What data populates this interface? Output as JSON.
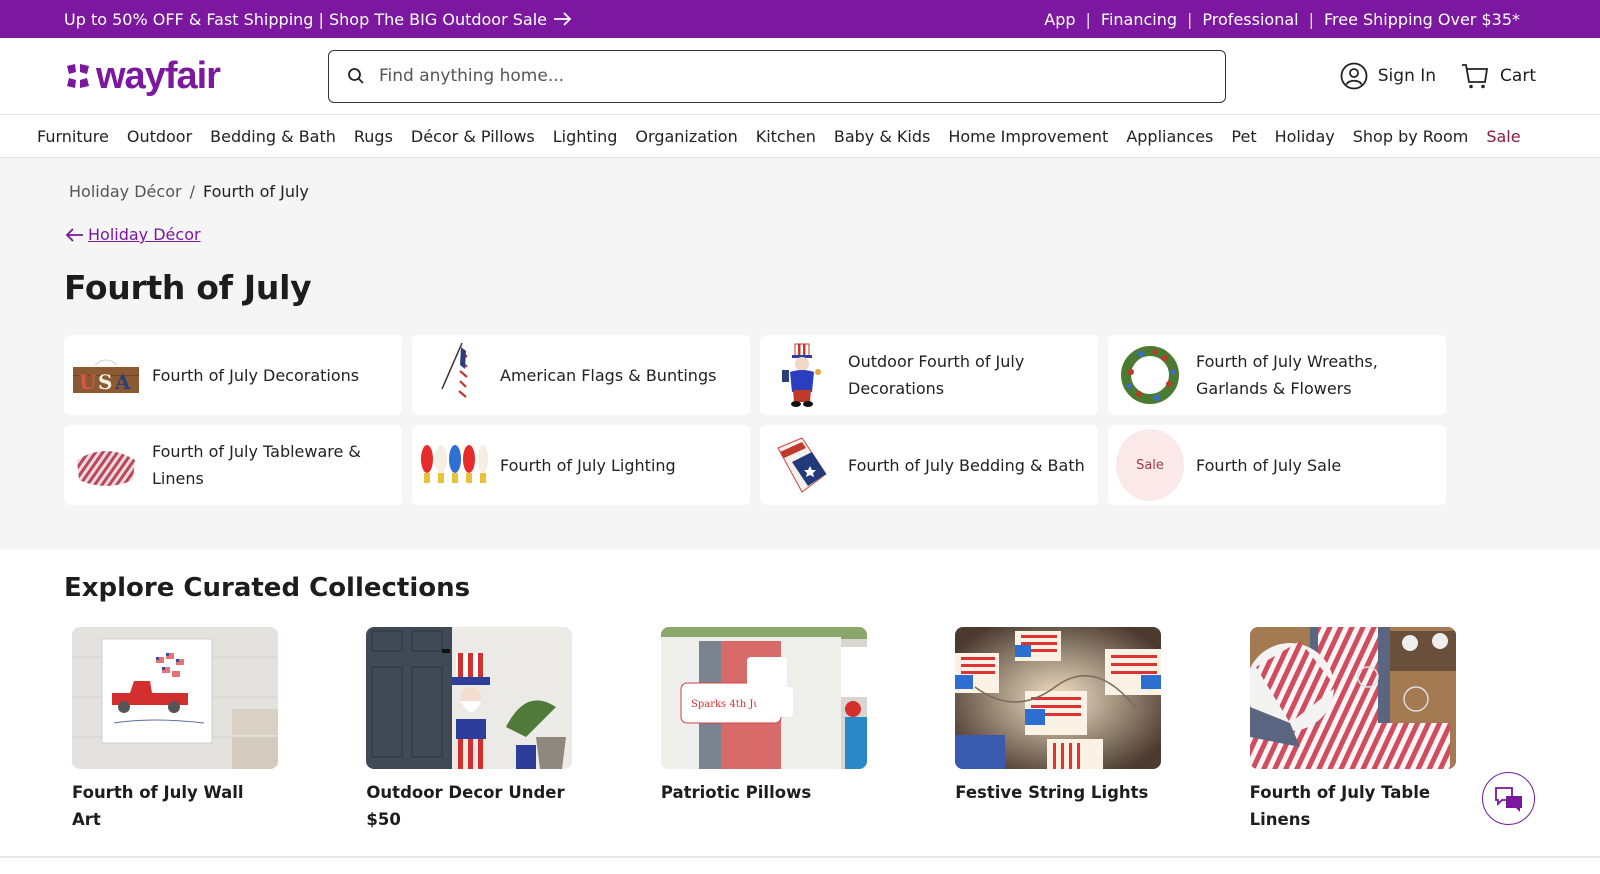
{
  "promo": {
    "left_text": "Up to 50% OFF & Fast Shipping | Shop The BIG Outdoor Sale",
    "right_links": [
      "App",
      "Financing",
      "Professional",
      "Free Shipping Over $35*"
    ]
  },
  "header": {
    "logo_text": "wayfair",
    "search_placeholder": "Find anything home...",
    "search_value": "",
    "sign_in_label": "Sign In",
    "cart_label": "Cart"
  },
  "nav": {
    "items": [
      "Furniture",
      "Outdoor",
      "Bedding & Bath",
      "Rugs",
      "Décor & Pillows",
      "Lighting",
      "Organization",
      "Kitchen",
      "Baby & Kids",
      "Home Improvement",
      "Appliances",
      "Pet",
      "Holiday",
      "Shop by Room",
      "Sale"
    ]
  },
  "breadcrumb": {
    "parent": "Holiday Décor",
    "separator": "/",
    "current": "Fourth of July"
  },
  "back_link": {
    "label": "Holiday Décor"
  },
  "page_title": "Fourth of July",
  "categories": [
    {
      "label": "Fourth of July Decorations",
      "image": "usa-sign"
    },
    {
      "label": "American Flags & Buntings",
      "image": "american-flag"
    },
    {
      "label": "Outdoor Fourth of July Decorations",
      "image": "uncle-sam-inflatable"
    },
    {
      "label": "Fourth of July Wreaths, Garlands & Flowers",
      "image": "wreath"
    },
    {
      "label": "Fourth of July Tableware & Linens",
      "image": "striped-tablecloth"
    },
    {
      "label": "Fourth of July Lighting",
      "image": "bulbs"
    },
    {
      "label": "Fourth of July Bedding & Bath",
      "image": "flag-blanket"
    },
    {
      "label": "Fourth of July Sale",
      "image": "sale-badge",
      "badge_text": "Sale"
    }
  ],
  "collections": {
    "title": "Explore Curated Collections",
    "items": [
      {
        "label": "Fourth of July Wall Art",
        "image": "red-truck-canvas"
      },
      {
        "label": "Outdoor Decor Under $50",
        "image": "uncle-sam-porch"
      },
      {
        "label": "Patriotic Pillows",
        "image": "pillows-on-chair"
      },
      {
        "label": "Festive String Lights",
        "image": "flag-string-lights"
      },
      {
        "label": "Fourth of July Table Linens",
        "image": "striped-napkins"
      }
    ]
  },
  "chat": {
    "icon": "chat-bubbles-icon"
  },
  "colors": {
    "brand_purple": "#7b189f",
    "sale_red": "#8a1a3e",
    "gray_bg": "#f5f5f5"
  }
}
